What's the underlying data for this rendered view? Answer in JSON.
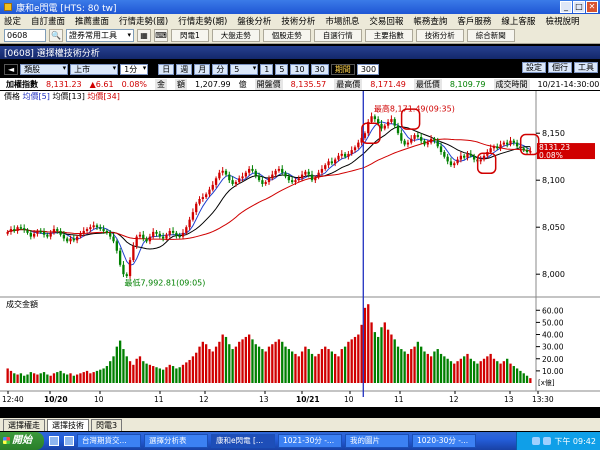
{
  "window": {
    "title": "康和e閃電 [HTS: 80 tw]",
    "buttons": [
      "_",
      "□",
      "✕"
    ]
  },
  "menu": [
    "設定",
    "自訂畫面",
    "推薦畫面",
    "行情走勢(國)",
    "行情走勢(期)",
    "盤後分析",
    "技術分析",
    "市場訊息",
    "交易回報",
    "帳務查詢",
    "客戶服務",
    "線上客服",
    "檢視說明"
  ],
  "toolbar": {
    "code": "0608",
    "group": "證券常用工具",
    "buttons": [
      "閃電1",
      "大盤走勢",
      "個股走勢",
      "自選行情",
      "主要指數",
      "技術分析",
      "綜合新聞"
    ]
  },
  "panel": {
    "title": "[0608] 選擇權技術分析"
  },
  "controls": {
    "category": "類股",
    "market": "上市",
    "period_sel": "1分",
    "units": [
      "日",
      "週",
      "月",
      "分"
    ],
    "number": "5",
    "ranges": [
      "1",
      "5",
      "10",
      "30"
    ],
    "range_label": "期間",
    "range_value": "300",
    "right_buttons": [
      "設定",
      "個行",
      "工具"
    ]
  },
  "info": {
    "name": "加權指數",
    "price": "8,131.23",
    "change": "▲6.61",
    "pct": "0.08%",
    "amount_label": "金",
    "amount_label2": "額",
    "amount": "1,207.99",
    "amount_unit": "億",
    "open_label": "開盤價",
    "open": "8,135.57",
    "high_label": "最高價",
    "high": "8,171.49",
    "low_label": "最低價",
    "low": "8,109.79",
    "time_label": "成交時間",
    "time": "10/21-14:30:00"
  },
  "legend": {
    "prefix": "價格",
    "ma1": "均價[5]",
    "ma2": "均價[13]",
    "ma3": "均價[34]"
  },
  "chart_data": {
    "type": "candlestick",
    "y_ticks": [
      "8,150",
      "8,100",
      "8,050",
      "8,000"
    ],
    "price_tag": "8131.23",
    "price_pct": "0.08%",
    "high_annotation": "最高8,171.49(09:35)",
    "low_annotation": "最低7,992.81(09:05)",
    "volume_title": "成交金額",
    "volume_ticks": [
      "60.00",
      "50.00",
      "40.00",
      "30.00",
      "20.00",
      "10.00"
    ],
    "volume_unit": "[x億]",
    "x_ticks": [
      "12:40",
      "10/20",
      "10",
      "11",
      "12",
      "13",
      "10/21",
      "10",
      "11",
      "12",
      "13",
      "13:30"
    ],
    "ylim": [
      7980,
      8180
    ],
    "closes": [
      8045,
      8048,
      8046,
      8050,
      8049,
      8047,
      8044,
      8040,
      8043,
      8046,
      8045,
      8042,
      8040,
      8044,
      8048,
      8046,
      8042,
      8038,
      8035,
      8038,
      8036,
      8040,
      8043,
      8046,
      8048,
      8050,
      8052,
      8050,
      8048,
      8046,
      8044,
      8040,
      8035,
      8025,
      8010,
      8000,
      7998,
      8015,
      8030,
      8040,
      8042,
      8038,
      8035,
      8040,
      8045,
      8043,
      8040,
      8038,
      8042,
      8046,
      8044,
      8041,
      8040,
      8044,
      8050,
      8058,
      8066,
      8075,
      8080,
      8082,
      8085,
      8090,
      8095,
      8102,
      8108,
      8110,
      8106,
      8100,
      8096,
      8098,
      8102,
      8104,
      8108,
      8112,
      8110,
      8105,
      8100,
      8096,
      8098,
      8102,
      8106,
      8110,
      8112,
      8108,
      8104,
      8100,
      8098,
      8100,
      8102,
      8106,
      8109,
      8106,
      8100,
      8103,
      8108,
      8112,
      8116,
      8120,
      8118,
      8122,
      8126,
      8128,
      8125,
      8128,
      8132,
      8135,
      8140,
      8145,
      8150,
      8162,
      8168,
      8165,
      8160,
      8155,
      8158,
      8162,
      8165,
      8158,
      8150,
      8142,
      8138,
      8140,
      8144,
      8148,
      8146,
      8142,
      8138,
      8140,
      8144,
      8142,
      8136,
      8130,
      8125,
      8120,
      8116,
      8118,
      8122,
      8126,
      8124,
      8128,
      8126,
      8122,
      8120,
      8122,
      8126,
      8130,
      8134,
      8136,
      8134,
      8138,
      8140,
      8138,
      8142,
      8140,
      8136,
      8134,
      8132,
      8130,
      8131
    ],
    "volumes": [
      12,
      10,
      8,
      7,
      8,
      6,
      7,
      9,
      8,
      7,
      8,
      9,
      7,
      6,
      8,
      9,
      10,
      8,
      7,
      8,
      6,
      7,
      8,
      9,
      10,
      8,
      9,
      10,
      11,
      12,
      14,
      18,
      22,
      30,
      35,
      28,
      22,
      18,
      15,
      20,
      22,
      18,
      16,
      15,
      14,
      13,
      12,
      11,
      13,
      15,
      14,
      12,
      13,
      15,
      17,
      19,
      22,
      25,
      30,
      34,
      32,
      28,
      26,
      30,
      34,
      40,
      38,
      32,
      28,
      30,
      34,
      36,
      38,
      40,
      36,
      32,
      30,
      28,
      26,
      30,
      32,
      34,
      36,
      34,
      30,
      28,
      26,
      24,
      22,
      26,
      30,
      28,
      24,
      22,
      24,
      28,
      30,
      28,
      26,
      24,
      22,
      28,
      30,
      34,
      36,
      38,
      40,
      48,
      62,
      65,
      50,
      42,
      38,
      46,
      50,
      44,
      40,
      36,
      30,
      28,
      26,
      24,
      28,
      30,
      34,
      30,
      26,
      24,
      22,
      26,
      28,
      24,
      22,
      20,
      18,
      16,
      18,
      20,
      22,
      24,
      20,
      18,
      16,
      18,
      20,
      22,
      24,
      20,
      18,
      16,
      18,
      20,
      16,
      14,
      12,
      10,
      8,
      6,
      4,
      66
    ]
  },
  "bottom_tabs": [
    "選擇權走",
    "選擇技術",
    "閃電3"
  ],
  "taskbar": {
    "start": "開始",
    "tasks": [
      "台灣期貨交...",
      "選擇分析表",
      "康和e閃電 [...",
      "1021-30分 -...",
      "我的圖片",
      "1020-30分 -..."
    ],
    "clock": "下午 09:42"
  }
}
